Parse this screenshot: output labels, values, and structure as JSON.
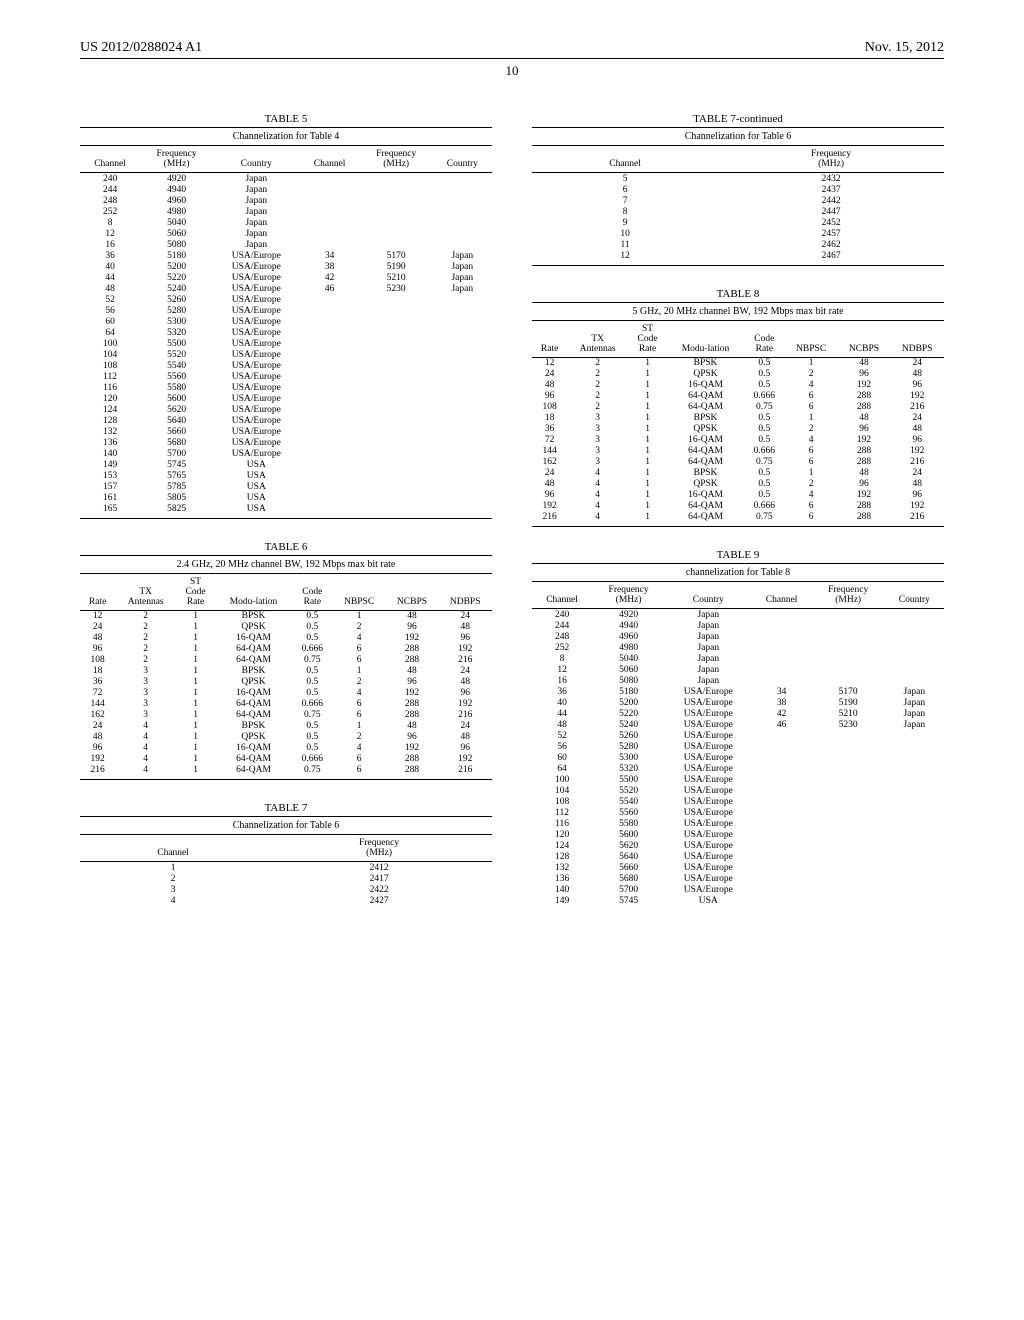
{
  "header": {
    "left": "US 2012/0288024 A1",
    "right": "Nov. 15, 2012"
  },
  "page_number": "10",
  "table5": {
    "title": "TABLE 5",
    "subtitle": "Channelization for Table 4",
    "headers": [
      "Channel",
      "Frequency (MHz)",
      "Country",
      "Channel",
      "Frequency (MHz)",
      "Country"
    ],
    "rows": [
      [
        "240",
        "4920",
        "Japan",
        "",
        "",
        ""
      ],
      [
        "244",
        "4940",
        "Japan",
        "",
        "",
        ""
      ],
      [
        "248",
        "4960",
        "Japan",
        "",
        "",
        ""
      ],
      [
        "252",
        "4980",
        "Japan",
        "",
        "",
        ""
      ],
      [
        "8",
        "5040",
        "Japan",
        "",
        "",
        ""
      ],
      [
        "12",
        "5060",
        "Japan",
        "",
        "",
        ""
      ],
      [
        "16",
        "5080",
        "Japan",
        "",
        "",
        ""
      ],
      [
        "36",
        "5180",
        "USA/Europe",
        "34",
        "5170",
        "Japan"
      ],
      [
        "40",
        "5200",
        "USA/Europe",
        "38",
        "5190",
        "Japan"
      ],
      [
        "44",
        "5220",
        "USA/Europe",
        "42",
        "5210",
        "Japan"
      ],
      [
        "48",
        "5240",
        "USA/Europe",
        "46",
        "5230",
        "Japan"
      ],
      [
        "52",
        "5260",
        "USA/Europe",
        "",
        "",
        ""
      ],
      [
        "56",
        "5280",
        "USA/Europe",
        "",
        "",
        ""
      ],
      [
        "60",
        "5300",
        "USA/Europe",
        "",
        "",
        ""
      ],
      [
        "64",
        "5320",
        "USA/Europe",
        "",
        "",
        ""
      ],
      [
        "100",
        "5500",
        "USA/Europe",
        "",
        "",
        ""
      ],
      [
        "104",
        "5520",
        "USA/Europe",
        "",
        "",
        ""
      ],
      [
        "108",
        "5540",
        "USA/Europe",
        "",
        "",
        ""
      ],
      [
        "112",
        "5560",
        "USA/Europe",
        "",
        "",
        ""
      ],
      [
        "116",
        "5580",
        "USA/Europe",
        "",
        "",
        ""
      ],
      [
        "120",
        "5600",
        "USA/Europe",
        "",
        "",
        ""
      ],
      [
        "124",
        "5620",
        "USA/Europe",
        "",
        "",
        ""
      ],
      [
        "128",
        "5640",
        "USA/Europe",
        "",
        "",
        ""
      ],
      [
        "132",
        "5660",
        "USA/Europe",
        "",
        "",
        ""
      ],
      [
        "136",
        "5680",
        "USA/Europe",
        "",
        "",
        ""
      ],
      [
        "140",
        "5700",
        "USA/Europe",
        "",
        "",
        ""
      ],
      [
        "149",
        "5745",
        "USA",
        "",
        "",
        ""
      ],
      [
        "153",
        "5765",
        "USA",
        "",
        "",
        ""
      ],
      [
        "157",
        "5785",
        "USA",
        "",
        "",
        ""
      ],
      [
        "161",
        "5805",
        "USA",
        "",
        "",
        ""
      ],
      [
        "165",
        "5825",
        "USA",
        "",
        "",
        ""
      ]
    ]
  },
  "table6": {
    "title": "TABLE 6",
    "subtitle": "2.4 GHz, 20 MHz channel BW, 192 Mbps max bit rate",
    "headers": [
      "Rate",
      "TX Antennas",
      "ST Code Rate",
      "Modu-lation",
      "Code Rate",
      "NBPSC",
      "NCBPS",
      "NDBPS"
    ],
    "rows": [
      [
        "12",
        "2",
        "1",
        "BPSK",
        "0.5",
        "1",
        "48",
        "24"
      ],
      [
        "24",
        "2",
        "1",
        "QPSK",
        "0.5",
        "2",
        "96",
        "48"
      ],
      [
        "48",
        "2",
        "1",
        "16-QAM",
        "0.5",
        "4",
        "192",
        "96"
      ],
      [
        "96",
        "2",
        "1",
        "64-QAM",
        "0.666",
        "6",
        "288",
        "192"
      ],
      [
        "108",
        "2",
        "1",
        "64-QAM",
        "0.75",
        "6",
        "288",
        "216"
      ],
      [
        "18",
        "3",
        "1",
        "BPSK",
        "0.5",
        "1",
        "48",
        "24"
      ],
      [
        "36",
        "3",
        "1",
        "QPSK",
        "0.5",
        "2",
        "96",
        "48"
      ],
      [
        "72",
        "3",
        "1",
        "16-QAM",
        "0.5",
        "4",
        "192",
        "96"
      ],
      [
        "144",
        "3",
        "1",
        "64-QAM",
        "0.666",
        "6",
        "288",
        "192"
      ],
      [
        "162",
        "3",
        "1",
        "64-QAM",
        "0.75",
        "6",
        "288",
        "216"
      ],
      [
        "24",
        "4",
        "1",
        "BPSK",
        "0.5",
        "1",
        "48",
        "24"
      ],
      [
        "48",
        "4",
        "1",
        "QPSK",
        "0.5",
        "2",
        "96",
        "48"
      ],
      [
        "96",
        "4",
        "1",
        "16-QAM",
        "0.5",
        "4",
        "192",
        "96"
      ],
      [
        "192",
        "4",
        "1",
        "64-QAM",
        "0.666",
        "6",
        "288",
        "192"
      ],
      [
        "216",
        "4",
        "1",
        "64-QAM",
        "0.75",
        "6",
        "288",
        "216"
      ]
    ]
  },
  "table7": {
    "title": "TABLE 7",
    "subtitle": "Channelization for Table 6",
    "headers": [
      "Channel",
      "Frequency (MHz)"
    ],
    "rows": [
      [
        "1",
        "2412"
      ],
      [
        "2",
        "2417"
      ],
      [
        "3",
        "2422"
      ],
      [
        "4",
        "2427"
      ]
    ]
  },
  "table7c": {
    "title": "TABLE 7-continued",
    "subtitle": "Channelization for Table 6",
    "headers": [
      "Channel",
      "Frequency (MHz)"
    ],
    "rows": [
      [
        "5",
        "2432"
      ],
      [
        "6",
        "2437"
      ],
      [
        "7",
        "2442"
      ],
      [
        "8",
        "2447"
      ],
      [
        "9",
        "2452"
      ],
      [
        "10",
        "2457"
      ],
      [
        "11",
        "2462"
      ],
      [
        "12",
        "2467"
      ]
    ]
  },
  "table8": {
    "title": "TABLE 8",
    "subtitle": "5 GHz, 20 MHz channel BW, 192 Mbps max bit rate",
    "headers": [
      "Rate",
      "TX Antennas",
      "ST Code Rate",
      "Modu-lation",
      "Code Rate",
      "NBPSC",
      "NCBPS",
      "NDBPS"
    ],
    "rows": [
      [
        "12",
        "2",
        "1",
        "BPSK",
        "0.5",
        "1",
        "48",
        "24"
      ],
      [
        "24",
        "2",
        "1",
        "QPSK",
        "0.5",
        "2",
        "96",
        "48"
      ],
      [
        "48",
        "2",
        "1",
        "16-QAM",
        "0.5",
        "4",
        "192",
        "96"
      ],
      [
        "96",
        "2",
        "1",
        "64-QAM",
        "0.666",
        "6",
        "288",
        "192"
      ],
      [
        "108",
        "2",
        "1",
        "64-QAM",
        "0.75",
        "6",
        "288",
        "216"
      ],
      [
        "18",
        "3",
        "1",
        "BPSK",
        "0.5",
        "1",
        "48",
        "24"
      ],
      [
        "36",
        "3",
        "1",
        "QPSK",
        "0.5",
        "2",
        "96",
        "48"
      ],
      [
        "72",
        "3",
        "1",
        "16-QAM",
        "0.5",
        "4",
        "192",
        "96"
      ],
      [
        "144",
        "3",
        "1",
        "64-QAM",
        "0.666",
        "6",
        "288",
        "192"
      ],
      [
        "162",
        "3",
        "1",
        "64-QAM",
        "0.75",
        "6",
        "288",
        "216"
      ],
      [
        "24",
        "4",
        "1",
        "BPSK",
        "0.5",
        "1",
        "48",
        "24"
      ],
      [
        "48",
        "4",
        "1",
        "QPSK",
        "0.5",
        "2",
        "96",
        "48"
      ],
      [
        "96",
        "4",
        "1",
        "16-QAM",
        "0.5",
        "4",
        "192",
        "96"
      ],
      [
        "192",
        "4",
        "1",
        "64-QAM",
        "0.666",
        "6",
        "288",
        "192"
      ],
      [
        "216",
        "4",
        "1",
        "64-QAM",
        "0.75",
        "6",
        "288",
        "216"
      ]
    ]
  },
  "table9": {
    "title": "TABLE 9",
    "subtitle": "channelization for Table 8",
    "headers": [
      "Channel",
      "Frequency (MHz)",
      "Country",
      "Channel",
      "Frequency (MHz)",
      "Country"
    ],
    "rows": [
      [
        "240",
        "4920",
        "Japan",
        "",
        "",
        ""
      ],
      [
        "244",
        "4940",
        "Japan",
        "",
        "",
        ""
      ],
      [
        "248",
        "4960",
        "Japan",
        "",
        "",
        ""
      ],
      [
        "252",
        "4980",
        "Japan",
        "",
        "",
        ""
      ],
      [
        "8",
        "5040",
        "Japan",
        "",
        "",
        ""
      ],
      [
        "12",
        "5060",
        "Japan",
        "",
        "",
        ""
      ],
      [
        "16",
        "5080",
        "Japan",
        "",
        "",
        ""
      ],
      [
        "36",
        "5180",
        "USA/Europe",
        "34",
        "5170",
        "Japan"
      ],
      [
        "40",
        "5200",
        "USA/Europe",
        "38",
        "5190",
        "Japan"
      ],
      [
        "44",
        "5220",
        "USA/Europe",
        "42",
        "5210",
        "Japan"
      ],
      [
        "48",
        "5240",
        "USA/Europe",
        "46",
        "5230",
        "Japan"
      ],
      [
        "52",
        "5260",
        "USA/Europe",
        "",
        "",
        ""
      ],
      [
        "56",
        "5280",
        "USA/Europe",
        "",
        "",
        ""
      ],
      [
        "60",
        "5300",
        "USA/Europe",
        "",
        "",
        ""
      ],
      [
        "64",
        "5320",
        "USA/Europe",
        "",
        "",
        ""
      ],
      [
        "100",
        "5500",
        "USA/Europe",
        "",
        "",
        ""
      ],
      [
        "104",
        "5520",
        "USA/Europe",
        "",
        "",
        ""
      ],
      [
        "108",
        "5540",
        "USA/Europe",
        "",
        "",
        ""
      ],
      [
        "112",
        "5560",
        "USA/Europe",
        "",
        "",
        ""
      ],
      [
        "116",
        "5580",
        "USA/Europe",
        "",
        "",
        ""
      ],
      [
        "120",
        "5600",
        "USA/Europe",
        "",
        "",
        ""
      ],
      [
        "124",
        "5620",
        "USA/Europe",
        "",
        "",
        ""
      ],
      [
        "128",
        "5640",
        "USA/Europe",
        "",
        "",
        ""
      ],
      [
        "132",
        "5660",
        "USA/Europe",
        "",
        "",
        ""
      ],
      [
        "136",
        "5680",
        "USA/Europe",
        "",
        "",
        ""
      ],
      [
        "140",
        "5700",
        "USA/Europe",
        "",
        "",
        ""
      ],
      [
        "149",
        "5745",
        "USA",
        "",
        "",
        ""
      ]
    ]
  }
}
